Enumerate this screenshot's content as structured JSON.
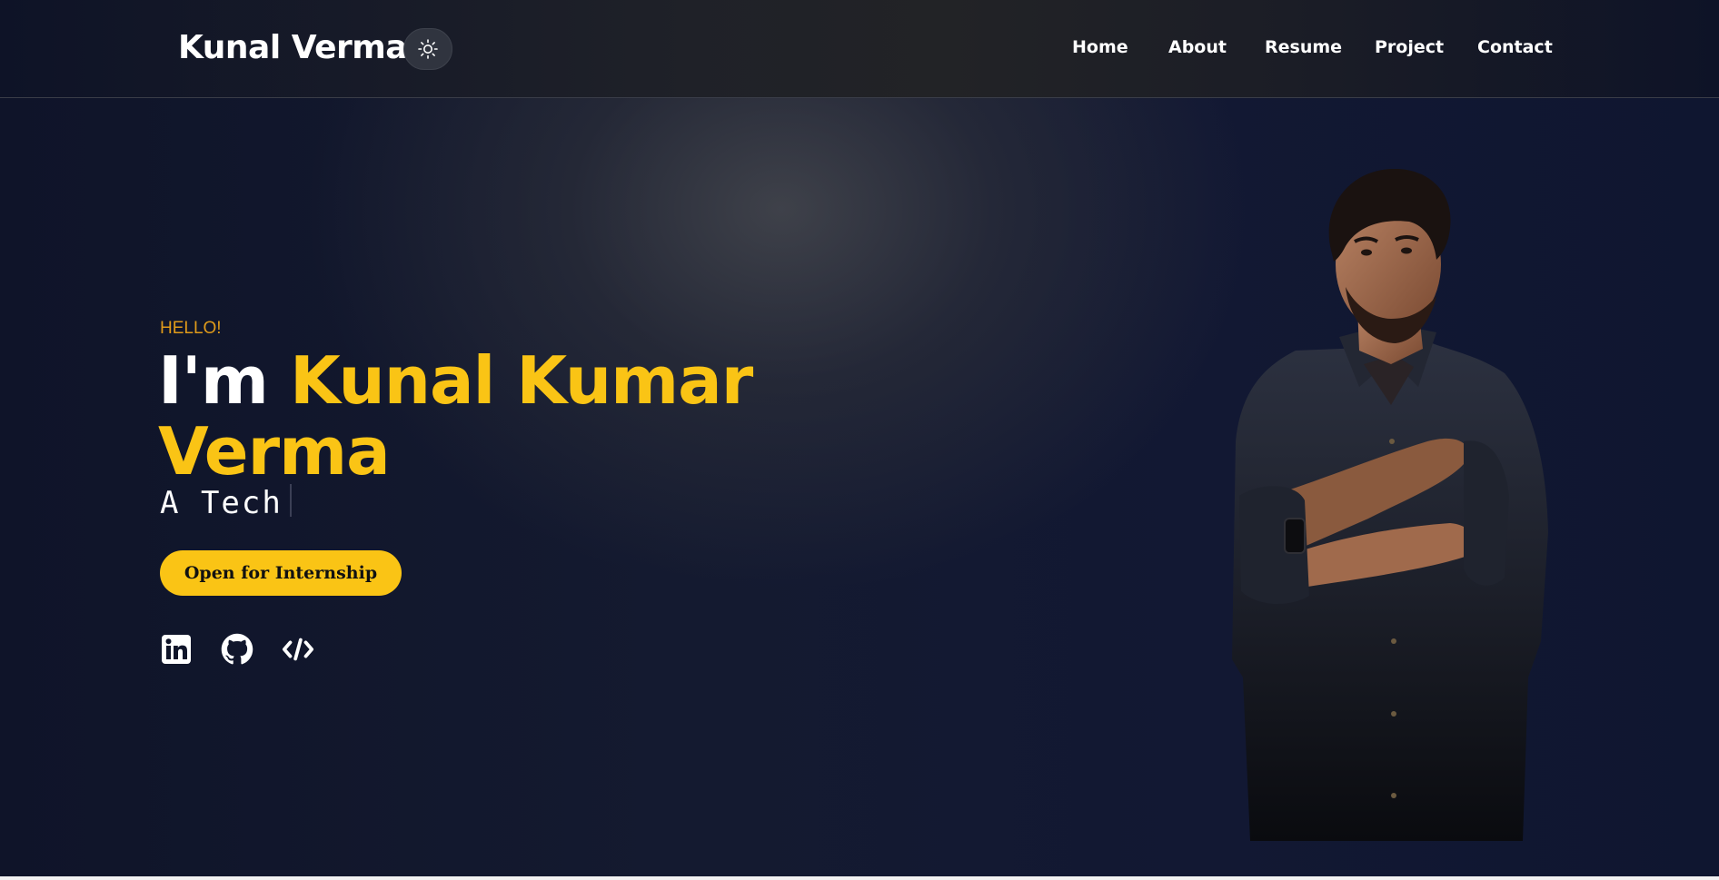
{
  "header": {
    "logo": "Kunal Verma",
    "theme_toggle_icon": "sun-icon",
    "nav": [
      {
        "label": "Home"
      },
      {
        "label": "About"
      },
      {
        "label": "Resume"
      },
      {
        "label": "Project"
      },
      {
        "label": "Contact"
      }
    ]
  },
  "hero": {
    "greeting": "HELLO!",
    "intro": "I'm",
    "name_line1": "Kunal Kumar",
    "name_line2": "Verma",
    "tagline": "A Tech",
    "cta_label": "Open for Internship",
    "social_icons": [
      "linkedin-icon",
      "github-icon",
      "code-icon"
    ]
  },
  "colors": {
    "accent": "#fac415",
    "greeting": "#e09b1a",
    "background": "#0f1429"
  }
}
